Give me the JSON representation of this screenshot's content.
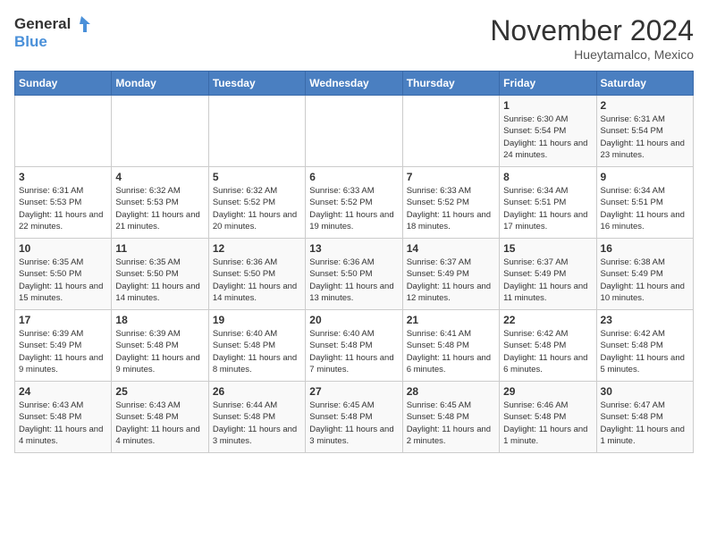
{
  "logo": {
    "text_general": "General",
    "text_blue": "Blue"
  },
  "title": "November 2024",
  "subtitle": "Hueytamalco, Mexico",
  "days_of_week": [
    "Sunday",
    "Monday",
    "Tuesday",
    "Wednesday",
    "Thursday",
    "Friday",
    "Saturday"
  ],
  "weeks": [
    [
      {
        "day": "",
        "info": ""
      },
      {
        "day": "",
        "info": ""
      },
      {
        "day": "",
        "info": ""
      },
      {
        "day": "",
        "info": ""
      },
      {
        "day": "",
        "info": ""
      },
      {
        "day": "1",
        "info": "Sunrise: 6:30 AM\nSunset: 5:54 PM\nDaylight: 11 hours and 24 minutes."
      },
      {
        "day": "2",
        "info": "Sunrise: 6:31 AM\nSunset: 5:54 PM\nDaylight: 11 hours and 23 minutes."
      }
    ],
    [
      {
        "day": "3",
        "info": "Sunrise: 6:31 AM\nSunset: 5:53 PM\nDaylight: 11 hours and 22 minutes."
      },
      {
        "day": "4",
        "info": "Sunrise: 6:32 AM\nSunset: 5:53 PM\nDaylight: 11 hours and 21 minutes."
      },
      {
        "day": "5",
        "info": "Sunrise: 6:32 AM\nSunset: 5:52 PM\nDaylight: 11 hours and 20 minutes."
      },
      {
        "day": "6",
        "info": "Sunrise: 6:33 AM\nSunset: 5:52 PM\nDaylight: 11 hours and 19 minutes."
      },
      {
        "day": "7",
        "info": "Sunrise: 6:33 AM\nSunset: 5:52 PM\nDaylight: 11 hours and 18 minutes."
      },
      {
        "day": "8",
        "info": "Sunrise: 6:34 AM\nSunset: 5:51 PM\nDaylight: 11 hours and 17 minutes."
      },
      {
        "day": "9",
        "info": "Sunrise: 6:34 AM\nSunset: 5:51 PM\nDaylight: 11 hours and 16 minutes."
      }
    ],
    [
      {
        "day": "10",
        "info": "Sunrise: 6:35 AM\nSunset: 5:50 PM\nDaylight: 11 hours and 15 minutes."
      },
      {
        "day": "11",
        "info": "Sunrise: 6:35 AM\nSunset: 5:50 PM\nDaylight: 11 hours and 14 minutes."
      },
      {
        "day": "12",
        "info": "Sunrise: 6:36 AM\nSunset: 5:50 PM\nDaylight: 11 hours and 14 minutes."
      },
      {
        "day": "13",
        "info": "Sunrise: 6:36 AM\nSunset: 5:50 PM\nDaylight: 11 hours and 13 minutes."
      },
      {
        "day": "14",
        "info": "Sunrise: 6:37 AM\nSunset: 5:49 PM\nDaylight: 11 hours and 12 minutes."
      },
      {
        "day": "15",
        "info": "Sunrise: 6:37 AM\nSunset: 5:49 PM\nDaylight: 11 hours and 11 minutes."
      },
      {
        "day": "16",
        "info": "Sunrise: 6:38 AM\nSunset: 5:49 PM\nDaylight: 11 hours and 10 minutes."
      }
    ],
    [
      {
        "day": "17",
        "info": "Sunrise: 6:39 AM\nSunset: 5:49 PM\nDaylight: 11 hours and 9 minutes."
      },
      {
        "day": "18",
        "info": "Sunrise: 6:39 AM\nSunset: 5:48 PM\nDaylight: 11 hours and 9 minutes."
      },
      {
        "day": "19",
        "info": "Sunrise: 6:40 AM\nSunset: 5:48 PM\nDaylight: 11 hours and 8 minutes."
      },
      {
        "day": "20",
        "info": "Sunrise: 6:40 AM\nSunset: 5:48 PM\nDaylight: 11 hours and 7 minutes."
      },
      {
        "day": "21",
        "info": "Sunrise: 6:41 AM\nSunset: 5:48 PM\nDaylight: 11 hours and 6 minutes."
      },
      {
        "day": "22",
        "info": "Sunrise: 6:42 AM\nSunset: 5:48 PM\nDaylight: 11 hours and 6 minutes."
      },
      {
        "day": "23",
        "info": "Sunrise: 6:42 AM\nSunset: 5:48 PM\nDaylight: 11 hours and 5 minutes."
      }
    ],
    [
      {
        "day": "24",
        "info": "Sunrise: 6:43 AM\nSunset: 5:48 PM\nDaylight: 11 hours and 4 minutes."
      },
      {
        "day": "25",
        "info": "Sunrise: 6:43 AM\nSunset: 5:48 PM\nDaylight: 11 hours and 4 minutes."
      },
      {
        "day": "26",
        "info": "Sunrise: 6:44 AM\nSunset: 5:48 PM\nDaylight: 11 hours and 3 minutes."
      },
      {
        "day": "27",
        "info": "Sunrise: 6:45 AM\nSunset: 5:48 PM\nDaylight: 11 hours and 3 minutes."
      },
      {
        "day": "28",
        "info": "Sunrise: 6:45 AM\nSunset: 5:48 PM\nDaylight: 11 hours and 2 minutes."
      },
      {
        "day": "29",
        "info": "Sunrise: 6:46 AM\nSunset: 5:48 PM\nDaylight: 11 hours and 1 minute."
      },
      {
        "day": "30",
        "info": "Sunrise: 6:47 AM\nSunset: 5:48 PM\nDaylight: 11 hours and 1 minute."
      }
    ]
  ]
}
